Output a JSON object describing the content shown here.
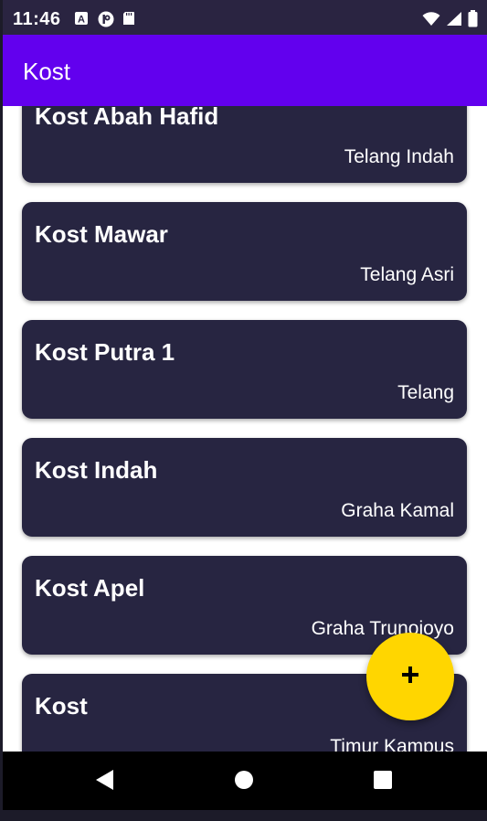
{
  "status_bar": {
    "time": "11:46",
    "left_icons": [
      "a-accessibility-icon",
      "p-app-icon",
      "sd-card-icon"
    ],
    "right_icons": [
      "wifi-icon",
      "signal-icon",
      "battery-icon"
    ]
  },
  "app_bar": {
    "title": "Kost"
  },
  "kost_list": [
    {
      "name": "Kost Abah Hafid",
      "location": "Telang Indah"
    },
    {
      "name": "Kost Mawar",
      "location": "Telang Asri"
    },
    {
      "name": "Kost Putra 1",
      "location": "Telang"
    },
    {
      "name": "Kost Indah",
      "location": "Graha Kamal"
    },
    {
      "name": "Kost Apel",
      "location": "Graha Trunojoyo"
    },
    {
      "name": "Kost",
      "location": "Timur Kampus"
    }
  ],
  "fab": {
    "icon": "plus-icon"
  },
  "nav_bar": {
    "buttons": [
      "back-icon",
      "home-icon",
      "recents-icon"
    ]
  },
  "colors": {
    "status_bar": "#2a2441",
    "app_bar": "#6200ee",
    "card": "#272541",
    "fab": "#ffd600",
    "nav_bar": "#000000"
  }
}
